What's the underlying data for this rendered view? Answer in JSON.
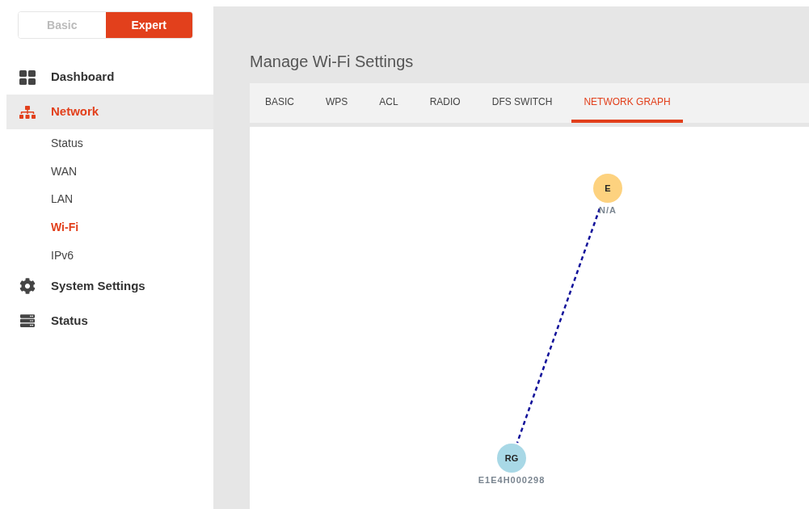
{
  "mode_toggle": [
    {
      "label": "Basic",
      "selected": false
    },
    {
      "label": "Expert",
      "selected": true
    }
  ],
  "nav": [
    {
      "label": "Dashboard",
      "selected": false
    },
    {
      "label": "Network",
      "selected": true,
      "children": [
        {
          "label": "Status",
          "selected": false
        },
        {
          "label": "WAN",
          "selected": false
        },
        {
          "label": "LAN",
          "selected": false
        },
        {
          "label": "Wi-Fi",
          "selected": true
        },
        {
          "label": "IPv6",
          "selected": false
        }
      ]
    },
    {
      "label": "System Settings",
      "selected": false
    },
    {
      "label": "Status",
      "selected": false
    }
  ],
  "page_title": "Manage Wi-Fi Settings",
  "tabs": [
    {
      "label": "BASIC",
      "selected": false
    },
    {
      "label": "WPS",
      "selected": false
    },
    {
      "label": "ACL",
      "selected": false
    },
    {
      "label": "RADIO",
      "selected": false
    },
    {
      "label": "DFS SWITCH",
      "selected": false
    },
    {
      "label": "NETWORK GRAPH",
      "selected": true
    }
  ],
  "graph": {
    "nodes": [
      {
        "label": "E",
        "caption": "N/A",
        "color": "#fdd27f"
      },
      {
        "label": "RG",
        "caption": "E1E4H000298",
        "color": "#a8d8e6"
      }
    ]
  }
}
